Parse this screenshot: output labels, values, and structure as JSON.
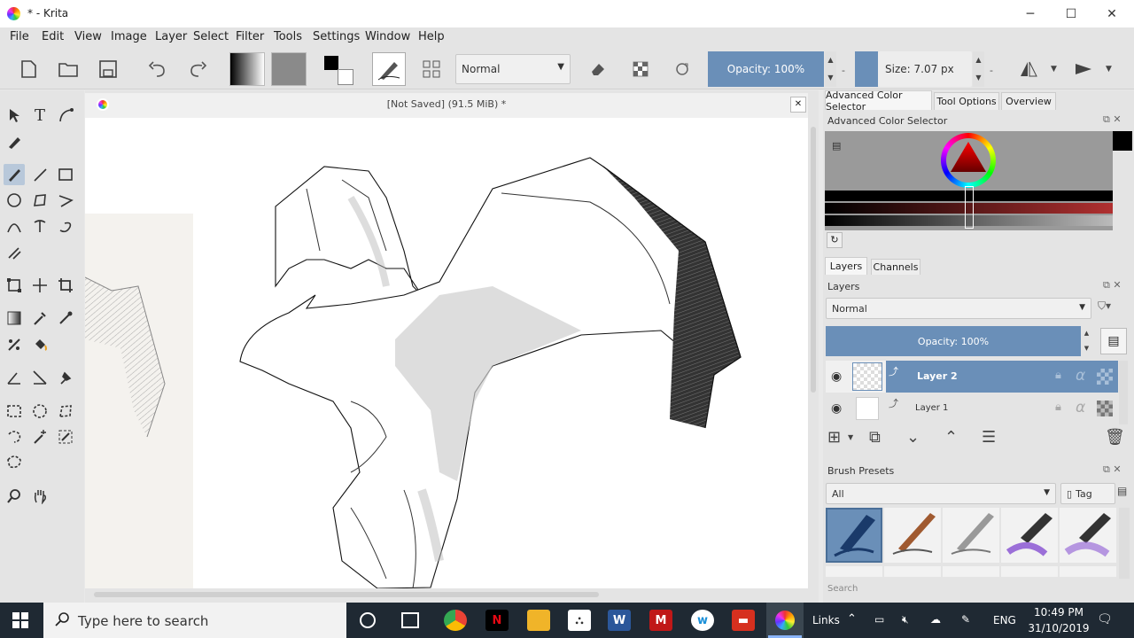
{
  "window": {
    "title": "* - Krita",
    "minimize": "─",
    "maximize": "☐",
    "close": "✕"
  },
  "menu": [
    "File",
    "Edit",
    "View",
    "Image",
    "Layer",
    "Select",
    "Filter",
    "Tools",
    "Settings",
    "Window",
    "Help"
  ],
  "toolbar": {
    "blend_mode": "Normal",
    "opacity_label": "Opacity:  100%",
    "size_label": "Size:  7.07 px"
  },
  "document": {
    "tab_title": "[Not Saved]  (91.5 MiB) *",
    "close": "✕"
  },
  "docker": {
    "tabs_top": [
      "Advanced Color Selector",
      "Tool Options",
      "Overview"
    ],
    "color_selector_title": "Advanced Color Selector",
    "layer_tabs": [
      "Layers",
      "Channels"
    ],
    "layers_title": "Layers",
    "layers_blend": "Normal",
    "layers_opacity": "Opacity:  100%",
    "layers": [
      {
        "name": "Layer 2",
        "selected": true
      },
      {
        "name": "Layer 1",
        "selected": false
      }
    ],
    "brush_presets_title": "Brush Presets",
    "brush_filter": "All",
    "tag_label": "Tag",
    "search_placeholder": "Search"
  },
  "taskbar": {
    "search_placeholder": "Type here to search",
    "links": "Links",
    "lang": "ENG",
    "time": "10:49 PM",
    "date": "31/10/2019"
  },
  "colors": {
    "accent": "#6a8fb8",
    "taskbar": "#1f2933"
  }
}
